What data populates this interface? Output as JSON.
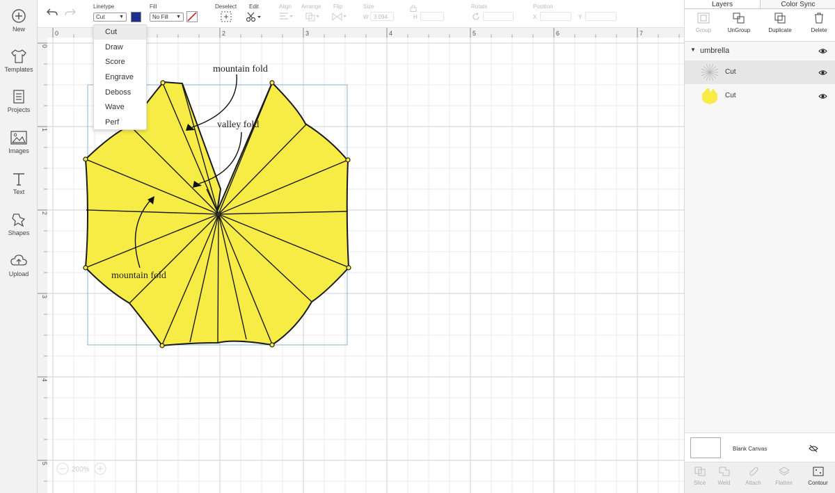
{
  "sidebar": {
    "items": [
      {
        "label": "New",
        "icon": "plus-circle-icon"
      },
      {
        "label": "Templates",
        "icon": "tshirt-icon"
      },
      {
        "label": "Projects",
        "icon": "projects-icon"
      },
      {
        "label": "Images",
        "icon": "image-icon"
      },
      {
        "label": "Text",
        "icon": "text-icon"
      },
      {
        "label": "Shapes",
        "icon": "shapes-icon"
      },
      {
        "label": "Upload",
        "icon": "upload-cloud-icon"
      }
    ]
  },
  "toolbar": {
    "linetype_label": "Linetype",
    "linetype_value": "Cut",
    "fill_label": "Fill",
    "fill_value": "No Fill",
    "fill_color": "#1f2f8f",
    "deselect_label": "Deselect",
    "edit_label": "Edit",
    "align_label": "Align",
    "arrange_label": "Arrange",
    "flip_label": "Flip",
    "size_label": "Size",
    "size_w_label": "W",
    "size_w_value": "3.094",
    "size_h_label": "H",
    "rotate_label": "Rotate",
    "position_label": "Position",
    "position_x_label": "X",
    "position_y_label": "Y"
  },
  "linetype_menu": {
    "options": [
      "Cut",
      "Draw",
      "Score",
      "Engrave",
      "Deboss",
      "Wave",
      "Perf"
    ],
    "selected": "Cut"
  },
  "canvas": {
    "ruler_x": [
      "0",
      "1",
      "2",
      "3",
      "4",
      "5",
      "6",
      "7"
    ],
    "ruler_y": [
      "0",
      "1",
      "2",
      "3",
      "4",
      "5"
    ],
    "zoom": "200%",
    "annotations": {
      "mountain_fold_top": "mountain fold",
      "valley_fold": "valley fold",
      "mountain_fold_bottom": "mountain fold"
    },
    "umbrella_color": "#f7ec46"
  },
  "panel": {
    "tabs": [
      "Layers",
      "Color Sync"
    ],
    "actions": [
      "Group",
      "UnGroup",
      "Duplicate",
      "Delete"
    ],
    "group_name": "umbrella",
    "layers": [
      {
        "label": "Cut"
      },
      {
        "label": "Cut"
      }
    ],
    "blank_canvas_label": "Blank Canvas",
    "bottom_actions": [
      "Slice",
      "Weld",
      "Attach",
      "Flatten",
      "Contour"
    ]
  }
}
